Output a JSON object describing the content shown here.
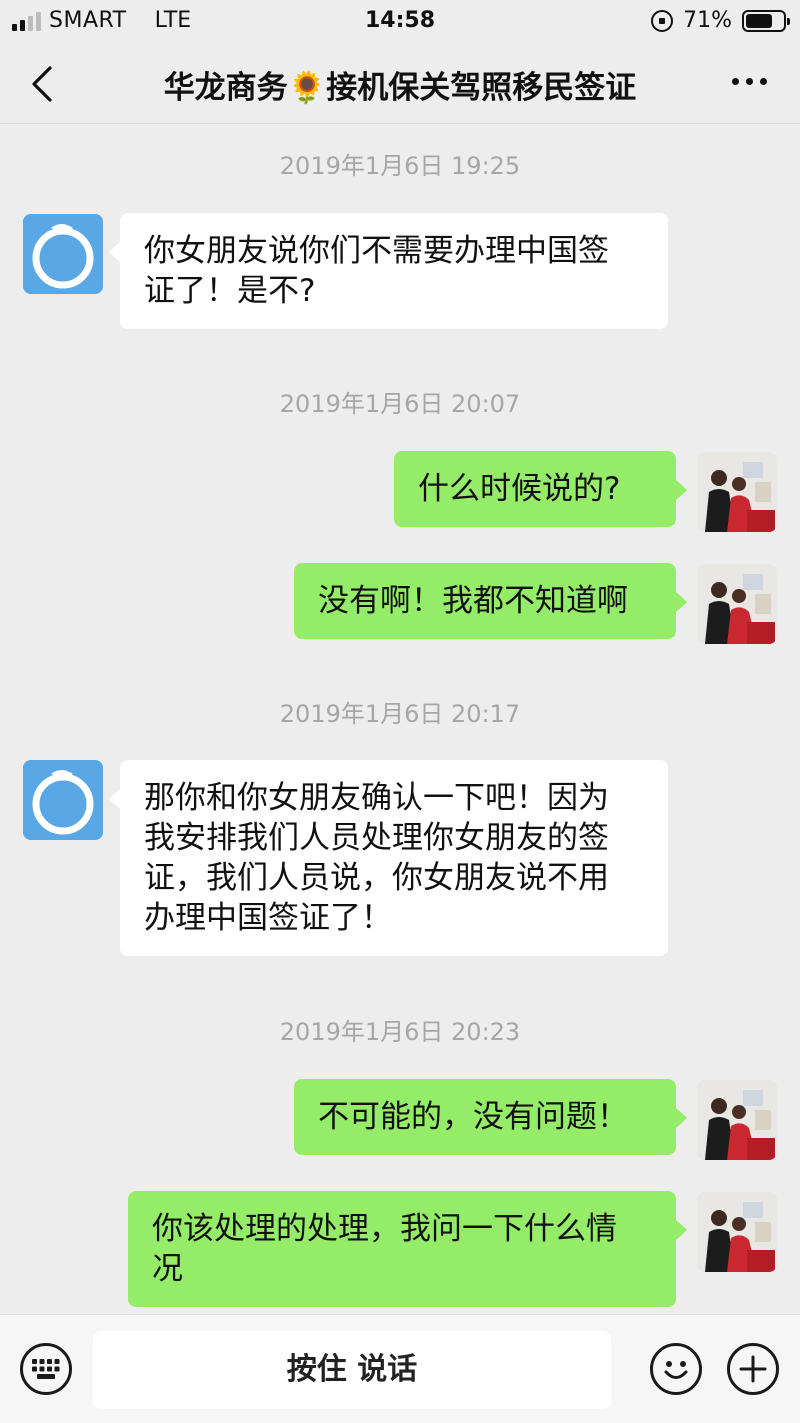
{
  "status_bar": {
    "carrier": "SMART",
    "network": "LTE",
    "time": "14:58",
    "battery_percent_text": "71%",
    "battery_level": 0.71,
    "signal_bars_active": 2,
    "signal_bars_total": 4
  },
  "nav": {
    "title": "华龙商务🌻接机保关驾照移民签证",
    "back_icon": "chevron-left-icon",
    "more_icon": "more-dots-icon"
  },
  "messages": [
    {
      "type": "time",
      "text": "2019年1月6日 19:25"
    },
    {
      "type": "in",
      "lines": [
        "你女朋友说你们不需要办理中国签",
        "证了！是不?"
      ]
    },
    {
      "type": "time",
      "text": "2019年1月6日 20:07"
    },
    {
      "type": "out",
      "lines": [
        "什么时候说的?"
      ]
    },
    {
      "type": "out",
      "lines": [
        "没有啊！我都不知道啊"
      ]
    },
    {
      "type": "time",
      "text": "2019年1月6日 20:17"
    },
    {
      "type": "in",
      "lines": [
        "那你和你女朋友确认一下吧！因为",
        "我安排我们人员处理你女朋友的签",
        "证，我们人员说，你女朋友说不用",
        "办理中国签证了！"
      ]
    },
    {
      "type": "time",
      "text": "2019年1月6日 20:23"
    },
    {
      "type": "out",
      "lines": [
        "不可能的，没有问题！"
      ]
    },
    {
      "type": "out",
      "lines": [
        "你该处理的处理，我问一下什么情",
        "况"
      ]
    }
  ],
  "input_bar": {
    "hold_to_talk_label": "按住 说话",
    "voice_icon": "keyboard-icon",
    "emoji_icon": "emoji-icon",
    "plus_icon": "plus-icon"
  },
  "colors": {
    "background": "#ededed",
    "outgoing_bubble": "#95ec69",
    "incoming_bubble": "#ffffff",
    "timestamp_text": "#a6a6a6"
  }
}
